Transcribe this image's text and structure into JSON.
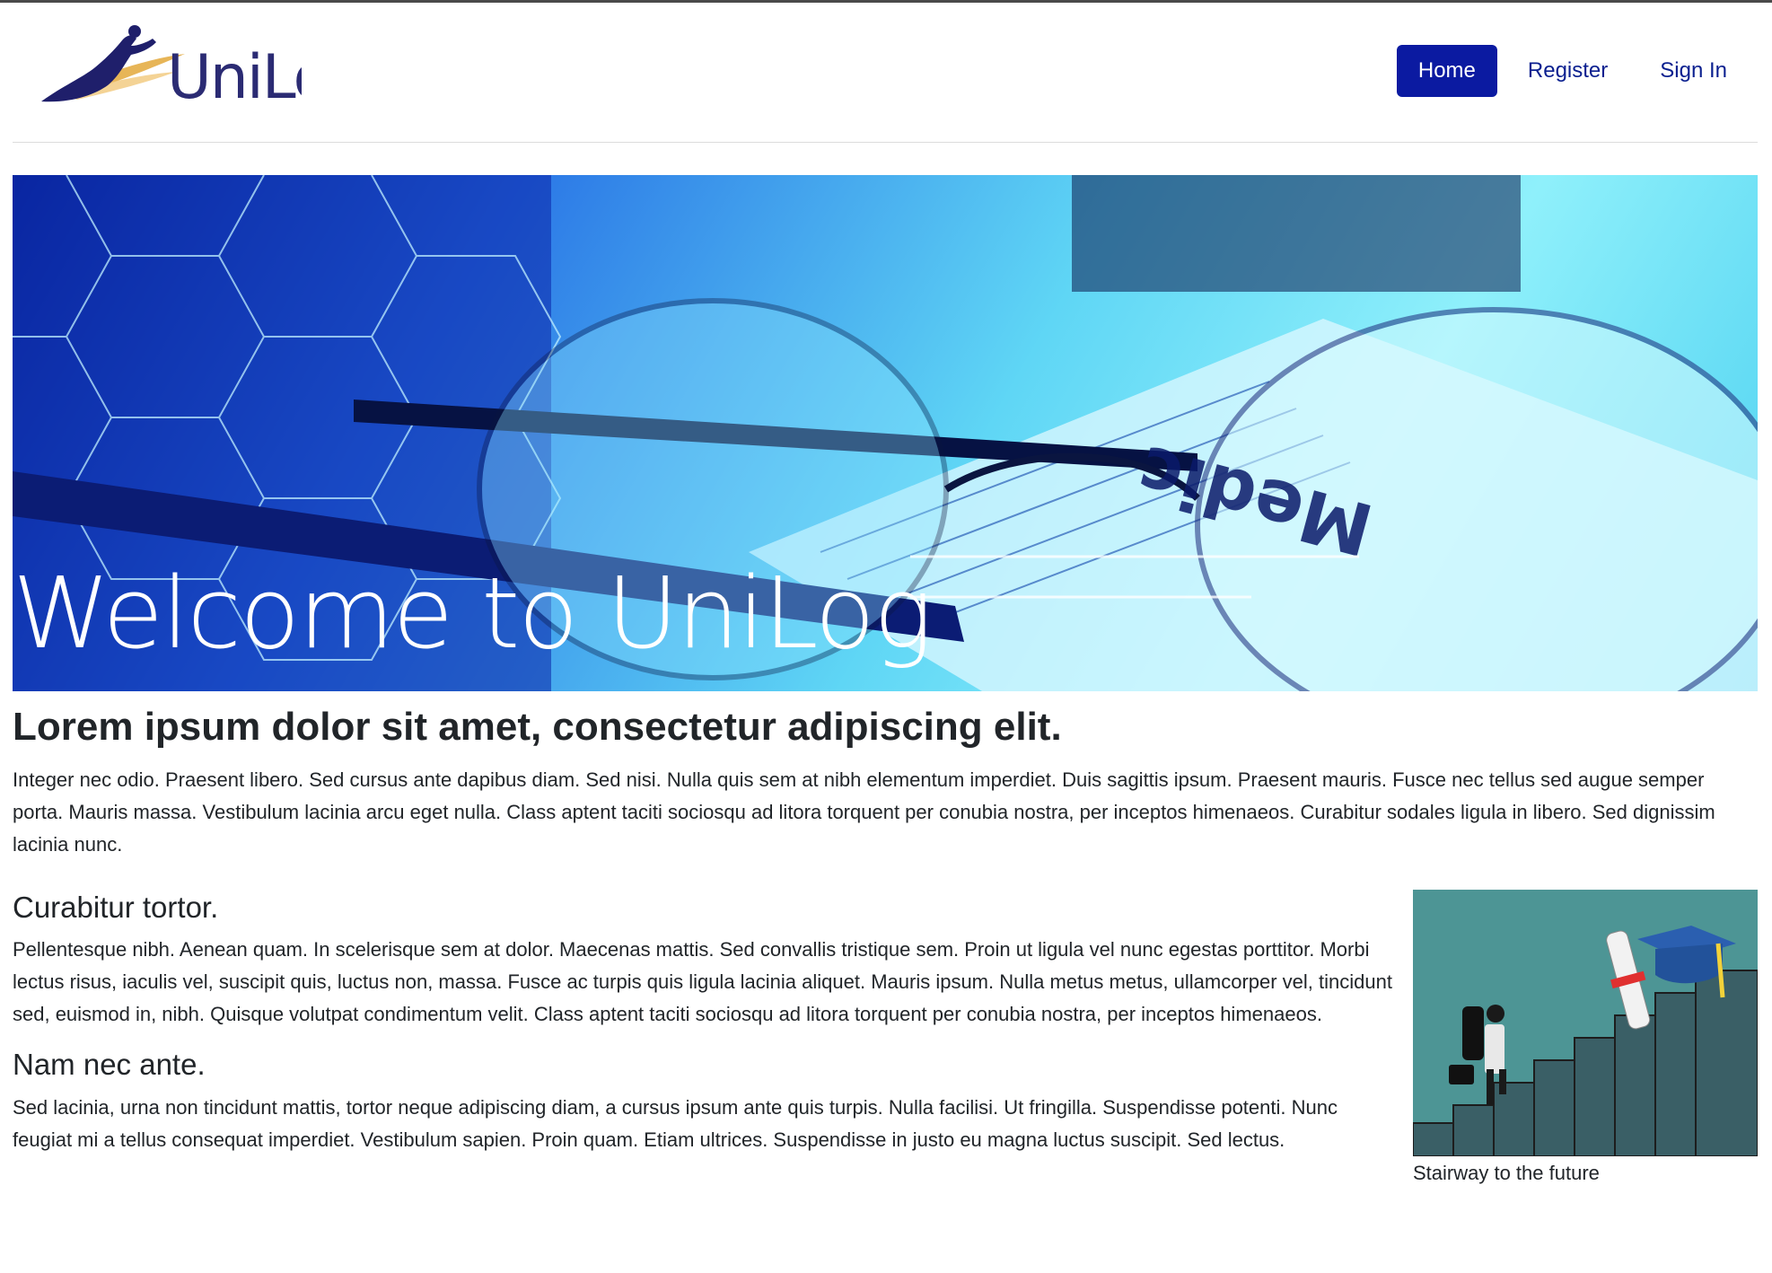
{
  "brand": {
    "name": "UniLog"
  },
  "nav": {
    "items": [
      {
        "label": "Home",
        "active": true
      },
      {
        "label": "Register",
        "active": false
      },
      {
        "label": "Sign In",
        "active": false
      }
    ]
  },
  "hero": {
    "title": "Welcome to UniLog"
  },
  "content": {
    "lead_title": "Lorem ipsum dolor sit amet, consectetur adipiscing elit.",
    "lead_text": "Integer nec odio. Praesent libero. Sed cursus ante dapibus diam. Sed nisi. Nulla quis sem at nibh elementum imperdiet. Duis sagittis ipsum. Praesent mauris. Fusce nec tellus sed augue semper porta. Mauris massa. Vestibulum lacinia arcu eget nulla. Class aptent taciti sociosqu ad litora torquent per conubia nostra, per inceptos himenaeos. Curabitur sodales ligula in libero. Sed dignissim lacinia nunc.",
    "section1_title": "Curabitur tortor.",
    "section1_text": "Pellentesque nibh. Aenean quam. In scelerisque sem at dolor. Maecenas mattis. Sed convallis tristique sem. Proin ut ligula vel nunc egestas porttitor. Morbi lectus risus, iaculis vel, suscipit quis, luctus non, massa. Fusce ac turpis quis ligula lacinia aliquet. Mauris ipsum. Nulla metus metus, ullamcorper vel, tincidunt sed, euismod in, nibh. Quisque volutpat condimentum velit. Class aptent taciti sociosqu ad litora torquent per conubia nostra, per inceptos himenaeos.",
    "section2_title": "Nam nec ante.",
    "section2_text": "Sed lacinia, urna non tincidunt mattis, tortor neque adipiscing diam, a cursus ipsum ante quis turpis. Nulla facilisi. Ut fringilla. Suspendisse potenti. Nunc feugiat mi a tellus consequat imperdiet. Vestibulum sapien. Proin quam. Etiam ultrices. Suspendisse in justo eu magna luctus suscipit. Sed lectus.",
    "figure_caption": "Stairway to the future"
  },
  "colors": {
    "brand_navy": "#0b1aa1",
    "link": "#0a1f8f",
    "logo_gold": "#e3a83a"
  }
}
